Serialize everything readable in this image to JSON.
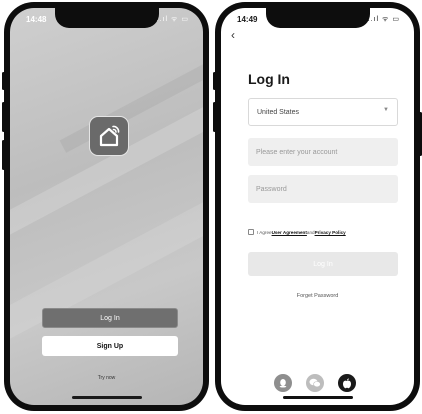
{
  "left_phone": {
    "status_time": "14:48",
    "status_icons": "..ıl ᯤ ▭",
    "buttons": {
      "login_label": "Log In",
      "signup_label": "Sign Up"
    },
    "try_now_label": "Try now"
  },
  "right_phone": {
    "status_time": "14:49",
    "status_icons": "..ıl ᯤ ▭",
    "back_icon": "‹",
    "title": "Log In",
    "country": {
      "value": "United States"
    },
    "account_placeholder": "Please enter your account",
    "password_placeholder": "Password",
    "agreement": {
      "prefix": "I Agree",
      "user_agreement": "User Agreement",
      "and": "and",
      "privacy_policy": "Privacy Policy"
    },
    "login_button_label": "Log In",
    "forgot_password_label": "Forget Password",
    "social_icons": [
      "qq-icon",
      "wechat-icon",
      "apple-icon"
    ]
  },
  "colors": {
    "left_bg": "#c4c4c4",
    "primary_button": "#6f6f6f",
    "disabled_button": "#e8e8e8",
    "input_bg": "#efefef"
  }
}
